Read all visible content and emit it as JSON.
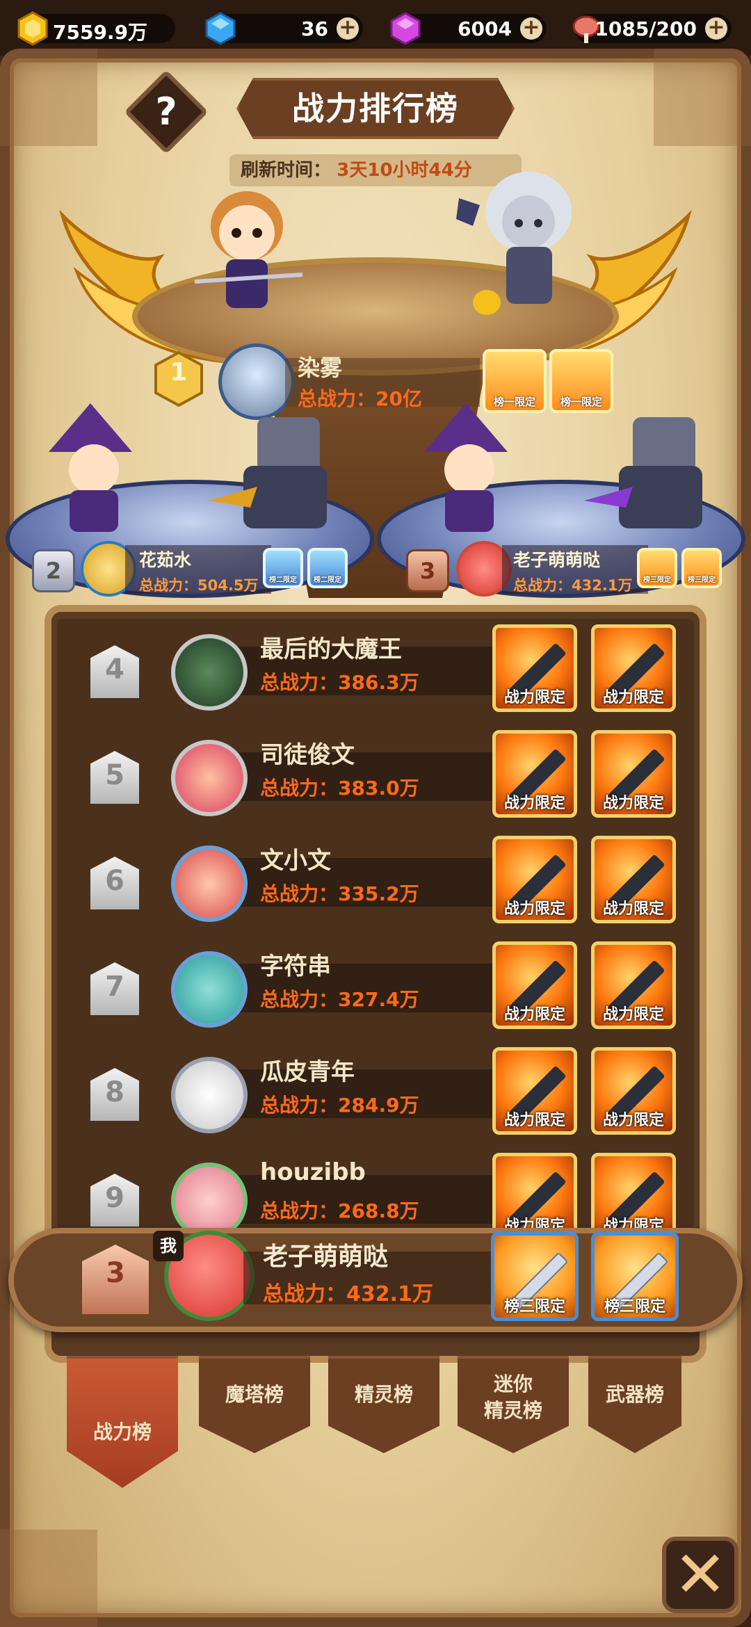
{
  "resources": {
    "gold": "7559.9万",
    "gems": "36",
    "crystals": "6004",
    "stamina": "1085/200"
  },
  "header": {
    "title": "战力排行榜",
    "help_symbol": "?",
    "refresh_label": "刷新时间：",
    "refresh_time": "3天10小时44分"
  },
  "podium": {
    "first": {
      "rank": "1",
      "name": "染雾",
      "power": "总战力：20亿",
      "badges": [
        "榜一限定",
        "榜一限定"
      ]
    },
    "second": {
      "rank": "2",
      "name": "花茹水",
      "power": "总战力：504.5万",
      "badges": [
        "榜二限定",
        "榜二限定"
      ]
    },
    "third": {
      "rank": "3",
      "name": "老子萌萌哒",
      "power": "总战力：432.1万",
      "badges": [
        "榜三限定",
        "榜三限定"
      ]
    }
  },
  "list": [
    {
      "rank": "4",
      "name": "最后的大魔王",
      "power": "总战力：386.3万",
      "w1": "战力限定",
      "w2": "战力限定"
    },
    {
      "rank": "5",
      "name": "司徒俊文",
      "power": "总战力：383.0万",
      "w1": "战力限定",
      "w2": "战力限定"
    },
    {
      "rank": "6",
      "name": "文小文",
      "power": "总战力：335.2万",
      "w1": "战力限定",
      "w2": "战力限定"
    },
    {
      "rank": "7",
      "name": "字符串",
      "power": "总战力：327.4万",
      "w1": "战力限定",
      "w2": "战力限定"
    },
    {
      "rank": "8",
      "name": "瓜皮青年",
      "power": "总战力：284.9万",
      "w1": "战力限定",
      "w2": "战力限定"
    },
    {
      "rank": "9",
      "name": "houzibb",
      "power": "总战力：268.8万",
      "w1": "战力限定",
      "w2": "战力限定"
    }
  ],
  "my_rank": {
    "tag": "我",
    "rank": "3",
    "name": "老子萌萌哒",
    "power": "总战力：432.1万",
    "w1": "榜三限定",
    "w2": "榜三限定"
  },
  "tabs": [
    {
      "label": "战力榜",
      "active": true
    },
    {
      "label": "魔塔榜",
      "active": false
    },
    {
      "label": "精灵榜",
      "active": false
    },
    {
      "label": "迷你\n精灵榜",
      "active": false
    },
    {
      "label": "武器榜",
      "active": false
    }
  ],
  "close_symbol": "✕",
  "colors": {
    "accent": "#ff6a1a",
    "panel": "#5a3a22",
    "gold_frame": "#f3d26a"
  }
}
